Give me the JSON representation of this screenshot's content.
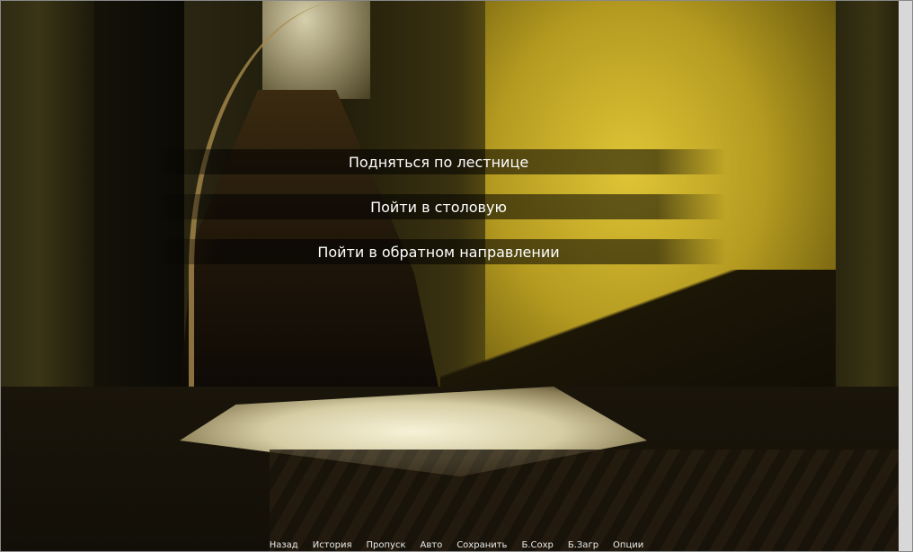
{
  "choices": [
    {
      "label": "Подняться по лестнице"
    },
    {
      "label": "Пойти в столовую"
    },
    {
      "label": "Пойти в обратном направлении"
    }
  ],
  "quick_menu": [
    {
      "label": "Назад"
    },
    {
      "label": "История"
    },
    {
      "label": "Пропуск"
    },
    {
      "label": "Авто"
    },
    {
      "label": "Сохранить"
    },
    {
      "label": "Б.Сохр"
    },
    {
      "label": "Б.Загр"
    },
    {
      "label": "Опции"
    }
  ]
}
